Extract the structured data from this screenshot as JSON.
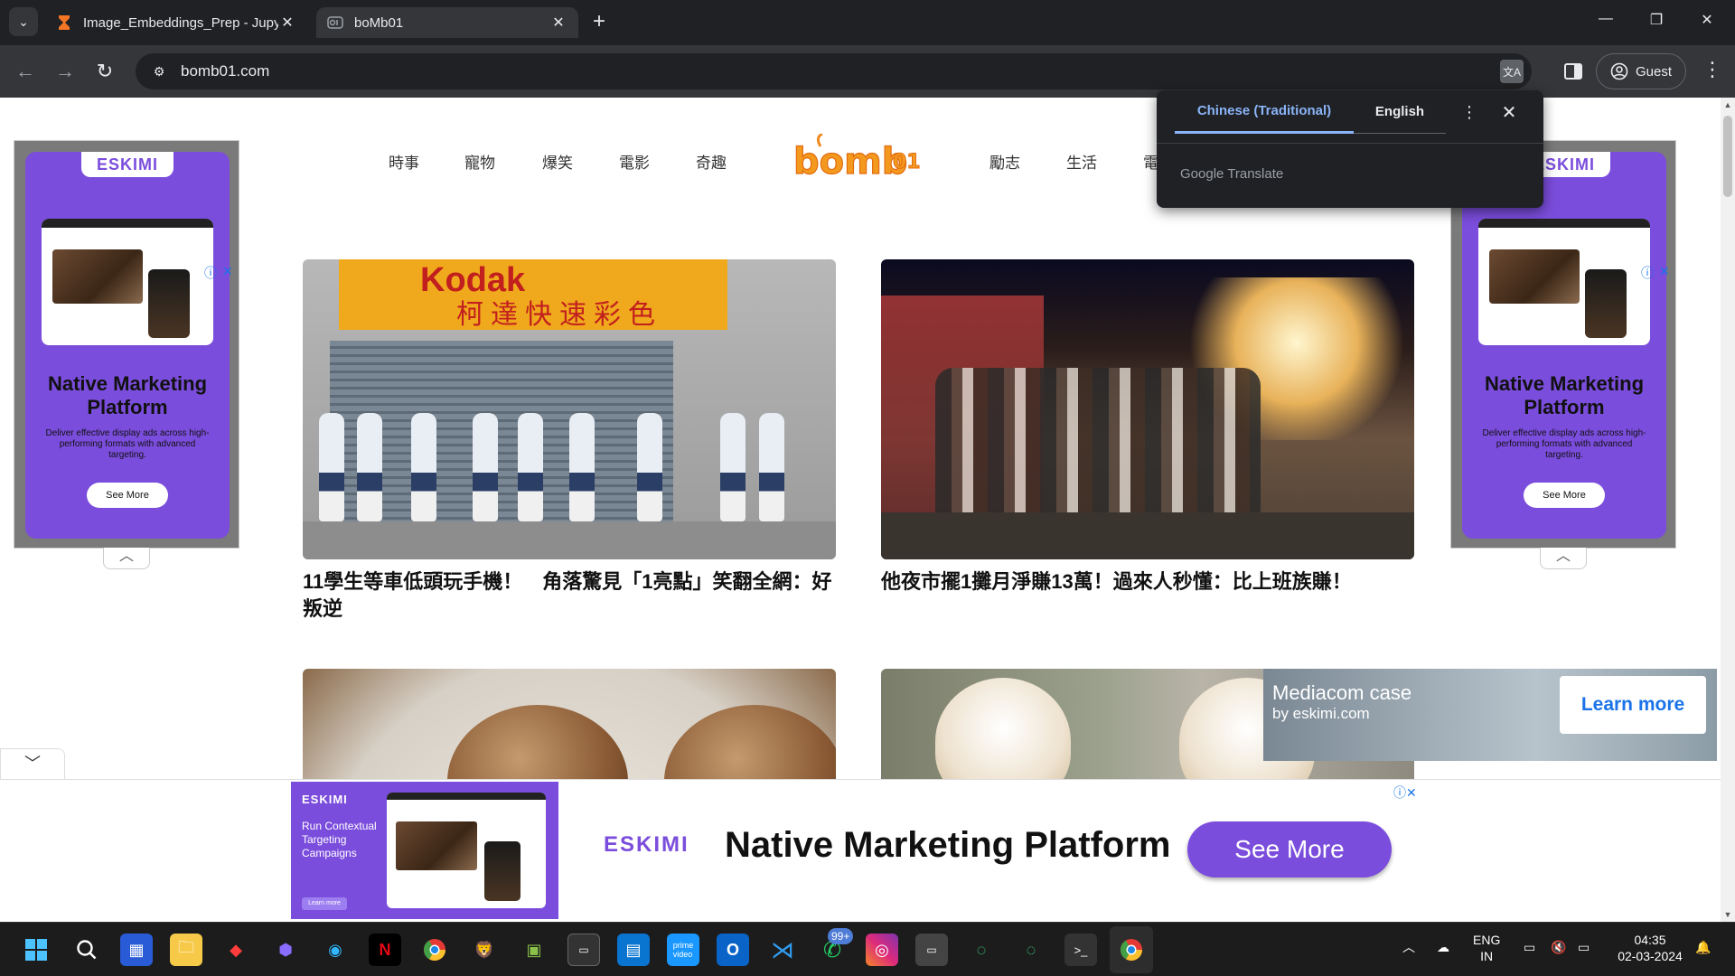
{
  "browser": {
    "tabs": [
      {
        "title": "Image_Embeddings_Prep - Jupy",
        "active": false
      },
      {
        "title": "boMb01",
        "active": true
      }
    ],
    "new_tab": "+",
    "url": "bomb01.com",
    "profile_label": "Guest",
    "window_controls": {
      "minimize": "—",
      "maximize": "❐",
      "close": "✕"
    }
  },
  "site": {
    "nav_left": [
      "時事",
      "寵物",
      "爆笑",
      "電影",
      "奇趣"
    ],
    "nav_right": [
      "勵志",
      "生活",
      "電"
    ],
    "logo_text": "bomb01",
    "articles": [
      {
        "headline": "11學生等車低頭玩手機！　角落驚見「1亮點」笑翻全網：好叛逆",
        "image": "kodak-storefront-students"
      },
      {
        "headline": "他夜市擺1攤月淨賺13萬！過來人秒懂：比上班族賺！",
        "image": "night-market-crowd"
      },
      {
        "headline": "",
        "image": "braised-eggs"
      },
      {
        "headline": "",
        "image": "golden-retriever-puppy"
      }
    ]
  },
  "side_ads": {
    "brand": "ESKIMI",
    "title": "Native Marketing Platform",
    "description": "Deliver effective display ads across high-performing formats with advanced targeting.",
    "button": "See More",
    "info_icon": "ⓘ",
    "close_icon": "✕"
  },
  "video_ad": {
    "title": "Mediacom case",
    "subtitle": "by eskimi.com",
    "button": "Learn more"
  },
  "bottom_banner": {
    "left_brand": "ESKIMI",
    "left_copy": "Run Contextual Targeting Campaigns",
    "left_button": "Learn more",
    "brand": "ESKIMI",
    "title": "Native Marketing Platform",
    "button": "See More"
  },
  "translate_popup": {
    "source_language": "Chinese (Traditional)",
    "target_language": "English",
    "provider": "Google Translate"
  },
  "taskbar": {
    "whatsapp_badge": "99+",
    "language": "ENG",
    "region": "IN",
    "time": "04:35",
    "date": "02-03-2024"
  },
  "colors": {
    "accent_purple": "#7b4ddc",
    "chrome_dark": "#202124",
    "chrome_toolbar": "#35363a",
    "translate_blue": "#8ab4f8",
    "link_blue": "#1a73e8"
  }
}
